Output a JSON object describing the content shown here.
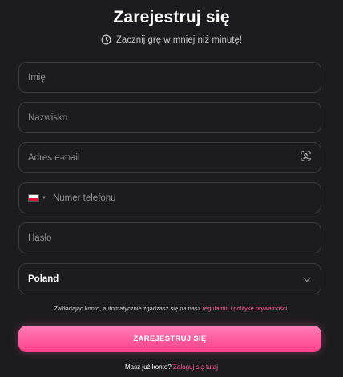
{
  "header": {
    "title": "Zarejestruj się",
    "subtitle": "Zacznij grę w mniej niż minutę!",
    "subtitle_icon": "clock-icon"
  },
  "form": {
    "first_name": {
      "placeholder": "Imię",
      "value": ""
    },
    "last_name": {
      "placeholder": "Nazwisko",
      "value": ""
    },
    "email": {
      "placeholder": "Adres e-mail",
      "value": "",
      "icon": "scan-face-icon"
    },
    "phone": {
      "placeholder": "Numer telefonu",
      "value": "",
      "country_flag": "poland-flag-icon"
    },
    "password": {
      "placeholder": "Hasło",
      "value": ""
    },
    "country": {
      "value": "Poland",
      "icon": "chevron-down-icon"
    }
  },
  "consent": {
    "text_before": "Zakładając konto, automatycznie zgadzasz się na nasz ",
    "link_text": "regulamin i politykę prywatności",
    "text_after": "."
  },
  "submit": {
    "label": "ZAREJESTRUJ SIĘ"
  },
  "footer": {
    "prompt": "Masz już konto? ",
    "link": "Zaloguj się tutaj"
  },
  "colors": {
    "background": "#1c1c20",
    "field_border": "#3a3a41",
    "accent": "#ff5c9d",
    "button_gradient_top": "#ff7db5",
    "button_gradient_bottom": "#ff3f8a"
  }
}
